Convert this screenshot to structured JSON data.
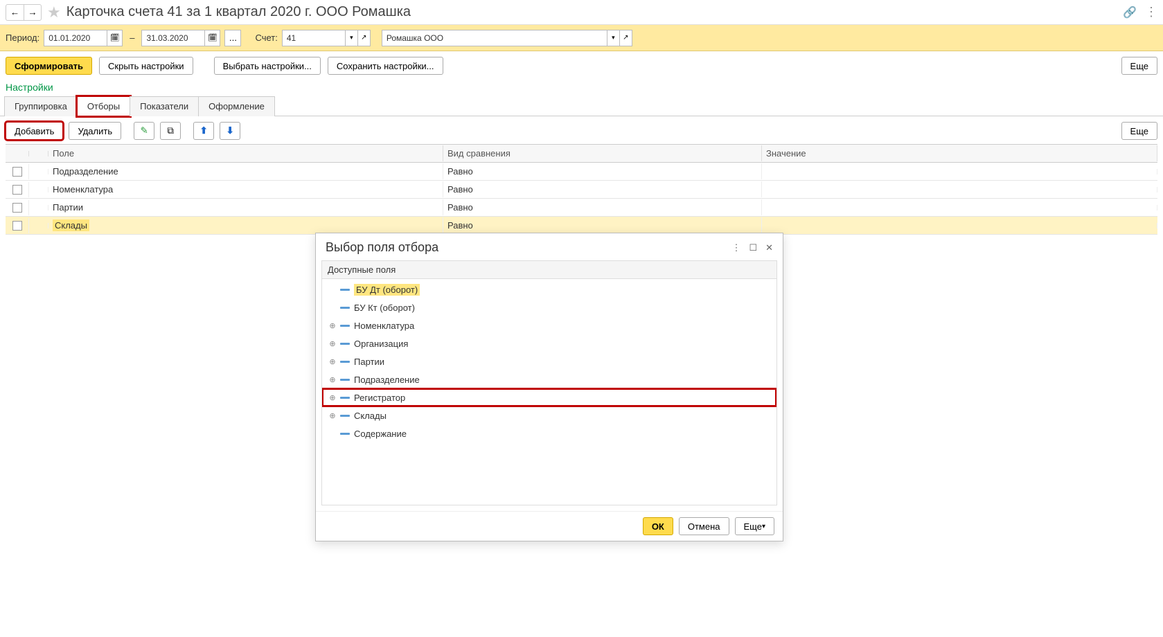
{
  "header": {
    "title": "Карточка счета 41 за 1 квартал 2020 г. ООО Ромашка"
  },
  "params": {
    "period_label": "Период:",
    "date_from": "01.01.2020",
    "date_to": "31.03.2020",
    "ellipsis": "...",
    "account_label": "Счет:",
    "account_value": "41",
    "org_value": "Ромашка ООО"
  },
  "actions": {
    "form": "Сформировать",
    "hide": "Скрыть настройки",
    "choose": "Выбрать настройки...",
    "save": "Сохранить настройки...",
    "more_right": "Еще"
  },
  "settings_label": "Настройки",
  "tabs": {
    "group": "Группировка",
    "filters": "Отборы",
    "indicators": "Показатели",
    "design": "Оформление"
  },
  "filter_toolbar": {
    "add": "Добавить",
    "delete": "Удалить",
    "more": "Еще"
  },
  "grid": {
    "col_field": "Поле",
    "col_cmp": "Вид сравнения",
    "col_val": "Значение",
    "rows": [
      {
        "field": "Подразделение",
        "cmp": "Равно"
      },
      {
        "field": "Номенклатура",
        "cmp": "Равно"
      },
      {
        "field": "Партии",
        "cmp": "Равно"
      },
      {
        "field": "Склады",
        "cmp": "Равно",
        "selected": true
      }
    ]
  },
  "dialog": {
    "title": "Выбор поля отбора",
    "subtitle": "Доступные поля",
    "items": [
      {
        "label": "БУ Дт (оборот)",
        "exp": false,
        "hl": true
      },
      {
        "label": "БУ Кт (оборот)",
        "exp": false
      },
      {
        "label": "Номенклатура",
        "exp": true
      },
      {
        "label": "Организация",
        "exp": true
      },
      {
        "label": "Партии",
        "exp": true
      },
      {
        "label": "Подразделение",
        "exp": true
      },
      {
        "label": "Регистратор",
        "exp": true,
        "boxed": true
      },
      {
        "label": "Склады",
        "exp": true
      },
      {
        "label": "Содержание",
        "exp": false
      }
    ],
    "ok": "ОК",
    "cancel": "Отмена",
    "more": "Еще"
  }
}
